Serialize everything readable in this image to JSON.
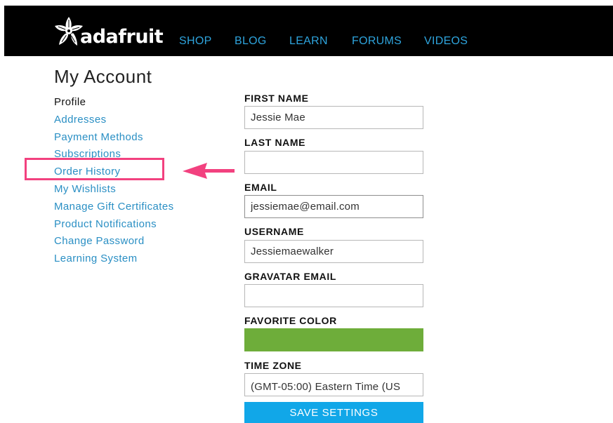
{
  "brand": {
    "name": "adafruit",
    "logo_icon": "adafruit-flower-star-icon"
  },
  "nav": {
    "items": [
      "SHOP",
      "BLOG",
      "LEARN",
      "FORUMS",
      "VIDEOS"
    ],
    "color": "#2ea4dd"
  },
  "page": {
    "title": "My Account"
  },
  "sidebar": {
    "items": [
      {
        "label": "Profile",
        "current": true
      },
      {
        "label": "Addresses"
      },
      {
        "label": "Payment Methods"
      },
      {
        "label": "Subscriptions"
      },
      {
        "label": "Order History",
        "highlighted": true
      },
      {
        "label": "My Wishlists"
      },
      {
        "label": "Manage Gift Certificates"
      },
      {
        "label": "Product Notifications"
      },
      {
        "label": "Change Password"
      },
      {
        "label": "Learning System"
      }
    ],
    "link_color": "#2a8fc4"
  },
  "annotation": {
    "highlight_color": "#f2417f",
    "arrow_icon": "left-arrow-icon"
  },
  "form": {
    "first_name": {
      "label": "FIRST NAME",
      "value": "Jessie Mae"
    },
    "last_name": {
      "label": "LAST NAME",
      "value": ""
    },
    "email": {
      "label": "EMAIL",
      "value": "jessiemae@email.com"
    },
    "username": {
      "label": "USERNAME",
      "value": "Jessiemaewalker"
    },
    "gravatar_email": {
      "label": "GRAVATAR EMAIL",
      "value": ""
    },
    "favorite_color": {
      "label": "FAVORITE COLOR",
      "value": "#6ead3a"
    },
    "time_zone": {
      "label": "TIME ZONE",
      "value": "(GMT-05:00) Eastern Time (US"
    },
    "save_label": "SAVE SETTINGS",
    "save_color": "#11a7e8"
  }
}
